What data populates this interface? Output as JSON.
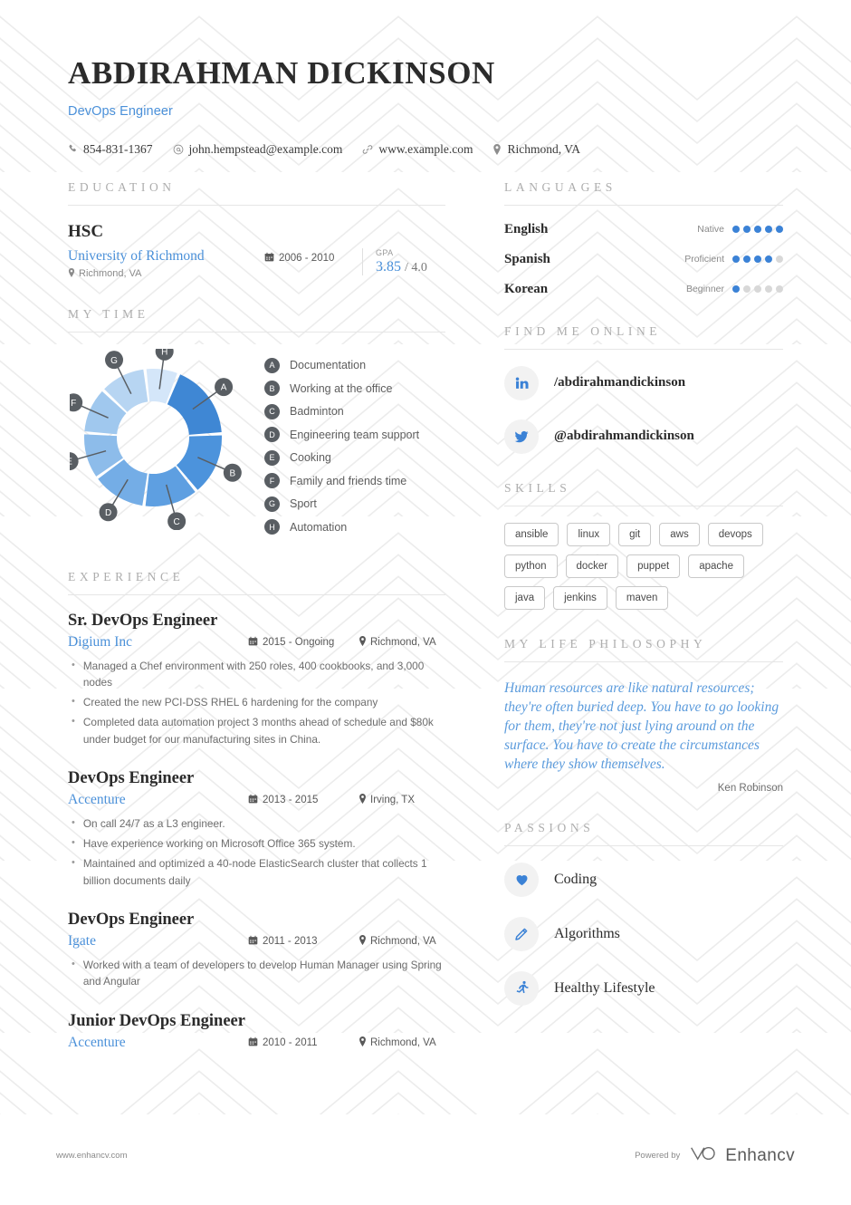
{
  "header": {
    "full_name": "ABDIRAHMAN DICKINSON",
    "job_title": "DevOps Engineer",
    "contacts": [
      {
        "icon": "phone-icon",
        "text": "854-831-1367"
      },
      {
        "icon": "email-icon",
        "text": "john.hempstead@example.com"
      },
      {
        "icon": "link-icon",
        "text": "www.example.com"
      },
      {
        "icon": "location-pin-icon",
        "text": "Richmond, VA"
      }
    ]
  },
  "education": {
    "section_title": "EDUCATION",
    "entries": [
      {
        "degree": "HSC",
        "school": "University of Richmond",
        "location": "Richmond, VA",
        "dates": "2006 - 2010",
        "gpa_label": "GPA",
        "gpa_value": "3.85",
        "gpa_max": "/ 4.0"
      }
    ]
  },
  "my_time": {
    "section_title": "MY TIME",
    "legend": [
      {
        "key": "A",
        "label": "Documentation"
      },
      {
        "key": "B",
        "label": "Working at the office"
      },
      {
        "key": "C",
        "label": "Badminton"
      },
      {
        "key": "D",
        "label": "Engineering team support"
      },
      {
        "key": "E",
        "label": "Cooking"
      },
      {
        "key": "F",
        "label": "Family and friends time"
      },
      {
        "key": "G",
        "label": "Sport"
      },
      {
        "key": "H",
        "label": "Automation"
      }
    ]
  },
  "chart_data": {
    "type": "pie",
    "title": "MY TIME",
    "subtype": "donut",
    "categories": [
      "Documentation",
      "Working at the office",
      "Badminton",
      "Engineering team support",
      "Cooking",
      "Family and friends time",
      "Sport",
      "Automation"
    ],
    "keys": [
      "A",
      "B",
      "C",
      "D",
      "E",
      "F",
      "G",
      "H"
    ],
    "values": [
      18,
      15,
      13,
      13,
      11,
      11,
      11,
      8
    ],
    "unit": "percent",
    "colors": [
      "#3f87d4",
      "#4c93dc",
      "#5e9fe1",
      "#74ade6",
      "#8dbcea",
      "#a0c8ee",
      "#b7d5f2",
      "#d4e6f9"
    ],
    "legend_position": "right",
    "grid": false
  },
  "experience": {
    "section_title": "EXPERIENCE",
    "jobs": [
      {
        "role": "Sr. DevOps Engineer",
        "company": "Digium Inc",
        "dates": "2015 - Ongoing",
        "location": "Richmond, VA",
        "bullets": [
          "Managed a Chef environment with 250 roles, 400 cookbooks, and 3,000 nodes",
          "Created the new PCI-DSS RHEL 6 hardening for the company",
          "Completed data automation project 3 months ahead of schedule and $80k under budget for our manufacturing sites in China."
        ]
      },
      {
        "role": "DevOps Engineer",
        "company": "Accenture",
        "dates": "2013 - 2015",
        "location": "Irving, TX",
        "bullets": [
          "On call 24/7 as a L3 engineer.",
          "Have experience working on Microsoft Office 365 system.",
          "Maintained and optimized a 40-node ElasticSearch cluster that collects 1 billion documents daily"
        ]
      },
      {
        "role": "DevOps Engineer",
        "company": "Igate",
        "dates": "2011 - 2013",
        "location": "Richmond, VA",
        "bullets": [
          "Worked with a team of developers to develop Human Manager using Spring and Angular"
        ]
      },
      {
        "role": "Junior DevOps Engineer",
        "company": "Accenture",
        "dates": "2010 - 2011",
        "location": "Richmond, VA",
        "bullets": []
      }
    ]
  },
  "languages": {
    "section_title": "LANGUAGES",
    "items": [
      {
        "name": "English",
        "level": "Native",
        "dots": 5
      },
      {
        "name": "Spanish",
        "level": "Proficient",
        "dots": 4
      },
      {
        "name": "Korean",
        "level": "Beginner",
        "dots": 1
      }
    ],
    "max_dots": 5
  },
  "find_me_online": {
    "section_title": "FIND ME ONLINE",
    "items": [
      {
        "icon": "linkedin-icon",
        "handle": "/abdirahmandickinson"
      },
      {
        "icon": "twitter-icon",
        "handle": "@abdirahmandickinson"
      }
    ]
  },
  "skills": {
    "section_title": "SKILLS",
    "tags": [
      "ansible",
      "linux",
      "git",
      "aws",
      "devops",
      "python",
      "docker",
      "puppet",
      "apache",
      "java",
      "jenkins",
      "maven"
    ]
  },
  "philosophy": {
    "section_title": "MY LIFE PHILOSOPHY",
    "quote": "Human resources are like natural resources; they're often buried deep. You have to go looking for them, they're not just lying around on the surface. You have to create the circumstances where they show themselves.",
    "author": "Ken Robinson"
  },
  "passions": {
    "section_title": "PASSIONS",
    "items": [
      {
        "icon": "heart-icon",
        "label": "Coding"
      },
      {
        "icon": "pencil-icon",
        "label": "Algorithms"
      },
      {
        "icon": "running-icon",
        "label": "Healthy Lifestyle"
      }
    ]
  },
  "footer": {
    "url": "www.enhancv.com",
    "powered_by": "Powered by",
    "brand": "Enhancv"
  },
  "colors": {
    "accent_blue": "#4a90d9",
    "heading_gray": "#adadad",
    "text_dark": "#2b2b2b"
  }
}
